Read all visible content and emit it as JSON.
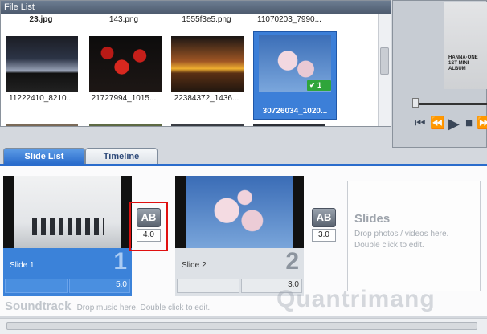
{
  "file_list": {
    "title": "File List",
    "row1": [
      "23.jpg",
      "143.png",
      "1555f3e5.png",
      "11070203_7990..."
    ],
    "row2": [
      "11222410_8210...",
      "21727994_1015...",
      "22384372_1436...",
      "30726034_1020..."
    ],
    "selected_badge": "1"
  },
  "preview": {
    "overlay_text_1": "HANNA·ONE",
    "overlay_text_2": "1ST MINI ALBUM",
    "controls": [
      "⏮",
      "⏪",
      "▶",
      "■",
      "⏩"
    ]
  },
  "tabs": {
    "slide_list": "Slide List",
    "timeline": "Timeline"
  },
  "slides": [
    {
      "label": "Slide 1",
      "number": "1",
      "duration": "5.0"
    },
    {
      "label": "Slide 2",
      "number": "2",
      "duration": "3.0"
    }
  ],
  "transitions": [
    {
      "icon_text": "AB",
      "value": "4.0"
    },
    {
      "icon_text": "AB",
      "value": "3.0"
    }
  ],
  "drop_zone": {
    "title": "Slides",
    "hint1": "Drop photos / videos here.",
    "hint2": "Double click to edit."
  },
  "soundtrack": {
    "label": "Soundtrack",
    "hint": "Drop music here.  Double click to edit."
  },
  "watermark": "Quantrimang",
  "colors": {
    "accent": "#2a6ccc",
    "highlight": "#e01010",
    "badge": "#2fa53a"
  }
}
